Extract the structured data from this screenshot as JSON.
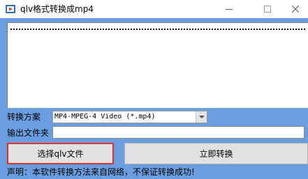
{
  "window": {
    "title": "qlv格式转换成mp4",
    "icon": "app-icon",
    "controls": [
      "minimize-icon",
      "maximize-icon",
      "close-icon"
    ]
  },
  "colors": {
    "client_bg": "#6b9ee0",
    "highlight_border": "#e03030"
  },
  "form": {
    "scheme_label": "转换方案",
    "scheme_value": "MP4-MPEG-4 Video (*.mp4)",
    "output_label": "输出文件夹",
    "output_value": ""
  },
  "buttons": {
    "select_file": "选择qlv文件",
    "convert_now": "立即转换"
  },
  "notice": "声明：本软件转换方法来自网络，不保证转换成功!"
}
